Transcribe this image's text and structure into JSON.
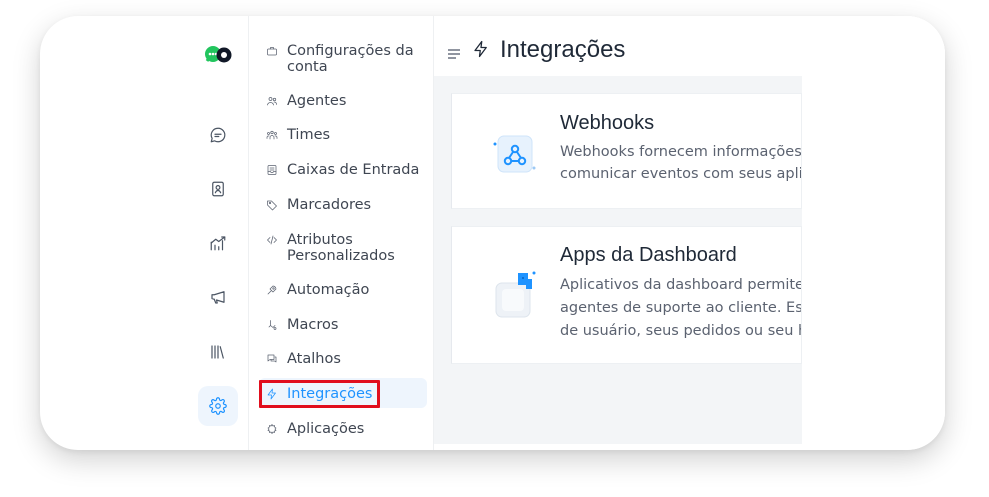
{
  "rail": {
    "icons": [
      "chat-icon",
      "contacts-icon",
      "reports-icon",
      "campaigns-icon",
      "library-icon",
      "settings-icon"
    ],
    "active": "settings-icon",
    "accent": "#1f93ff"
  },
  "menu": {
    "items": [
      {
        "label": "Configurações da conta",
        "line1": "Configurações da",
        "line2": "conta",
        "icon": "briefcase-icon"
      },
      {
        "label": "Agentes",
        "icon": "people-icon"
      },
      {
        "label": "Times",
        "icon": "team-icon"
      },
      {
        "label": "Caixas de Entrada",
        "icon": "inbox-icon"
      },
      {
        "label": "Marcadores",
        "icon": "tag-icon"
      },
      {
        "label": "Atributos Personalizados",
        "line1": "Atributos",
        "line2": "Personalizados",
        "icon": "code-icon"
      },
      {
        "label": "Automação",
        "icon": "automation-icon"
      },
      {
        "label": "Macros",
        "icon": "macro-icon"
      },
      {
        "label": "Atalhos",
        "icon": "chat-bubbles-icon"
      },
      {
        "label": "Integrações",
        "icon": "bolt-icon",
        "active": true
      },
      {
        "label": "Aplicações",
        "icon": "puzzle-icon"
      }
    ],
    "highlight_color": "#e10e1d"
  },
  "header": {
    "title": "Integrações",
    "icon": "bolt-icon"
  },
  "integrations": [
    {
      "name": "Webhooks",
      "desc_line1": "Webhooks fornecem informações em",
      "desc_line2": "comunicar eventos com seus aplicativ",
      "icon": "webhook-icon"
    },
    {
      "name": "Apps da Dashboard",
      "desc_line1": "Aplicativos da dashboard permitem o",
      "desc_line2": "agentes de suporte ao cliente. Este re",
      "desc_line3": "de usuário, seus pedidos ou seu histó",
      "icon": "puzzle-art-icon"
    }
  ]
}
